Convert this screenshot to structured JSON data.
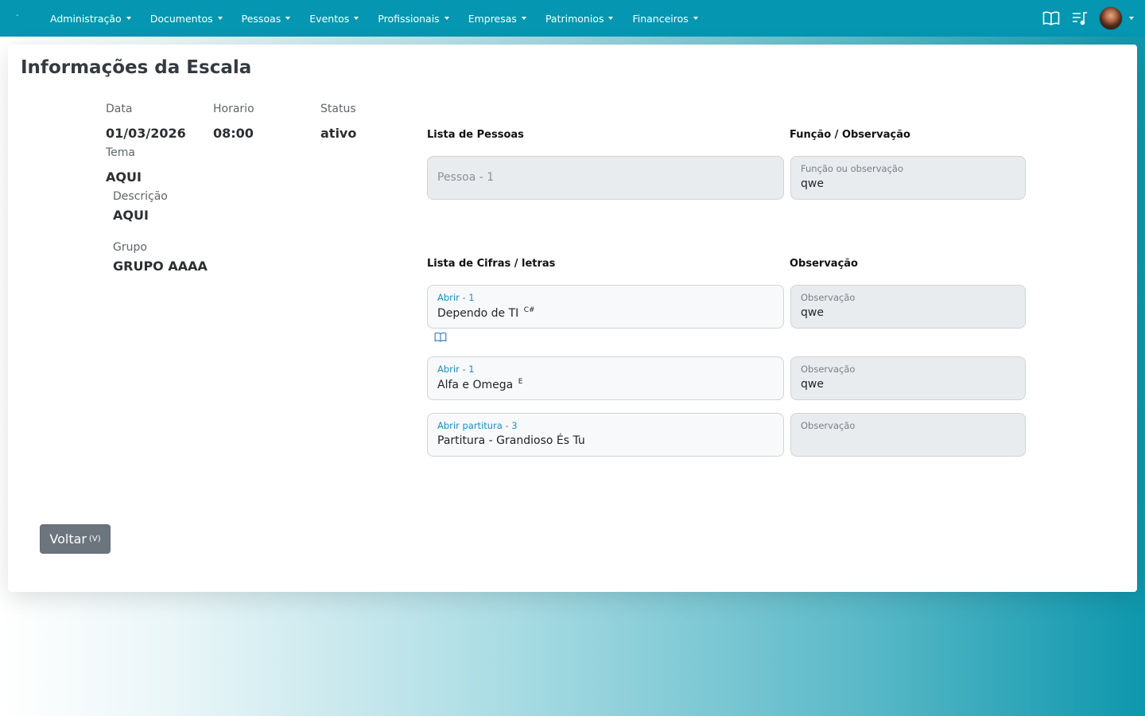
{
  "navbar": {
    "brand": "-",
    "items": [
      {
        "label": "Administração"
      },
      {
        "label": "Documentos"
      },
      {
        "label": "Pessoas"
      },
      {
        "label": "Eventos"
      },
      {
        "label": "Profissionais"
      },
      {
        "label": "Empresas"
      },
      {
        "label": "Patrimonios"
      },
      {
        "label": "Financeiros"
      }
    ],
    "right_icons": [
      "book-open-icon",
      "music-list-icon"
    ]
  },
  "page": {
    "title": "Informações da Escala"
  },
  "info": {
    "data_label": "Data",
    "data_value": "01/03/2026",
    "horario_label": "Horario",
    "horario_value": "08:00",
    "status_label": "Status",
    "status_value": "ativo",
    "tema_label": "Tema",
    "tema_value": "AQUI",
    "descricao_label": "Descrição",
    "descricao_value": "AQUI",
    "grupo_label": "Grupo",
    "grupo_value": "GRUPO AAAA"
  },
  "pessoas": {
    "header": "Lista de Pessoas",
    "funcao_header": "Função / Observação",
    "rows": [
      {
        "person_placeholder": "Pessoa - 1",
        "funcao_label": "Função ou observação",
        "funcao_value": "qwe"
      }
    ]
  },
  "cifras": {
    "header": "Lista de Cifras / letras",
    "obs_header": "Observação",
    "rows": [
      {
        "link": "Abrir - 1",
        "title": "Dependo de TI",
        "key": "C#",
        "obs_label": "Observação",
        "obs_value": "qwe"
      },
      {
        "link": "Abrir - 1",
        "title": "Alfa e Omega",
        "key": "E",
        "obs_label": "Observação",
        "obs_value": "qwe"
      },
      {
        "link": "Abrir partitura - 3",
        "title": "Partitura - Grandioso És Tu",
        "key": "",
        "obs_label": "Observação",
        "obs_value": ""
      }
    ]
  },
  "actions": {
    "back_label": "Voltar",
    "back_shortcut": "(V)"
  },
  "colors": {
    "navbar": "#0596b2",
    "link": "#1d8fc7",
    "button": "#6c757d"
  }
}
